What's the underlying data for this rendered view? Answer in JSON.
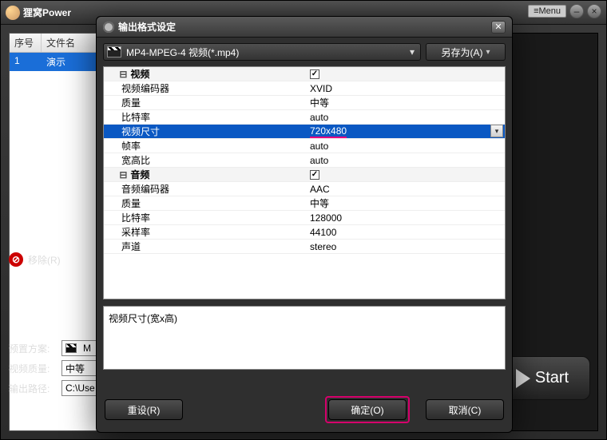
{
  "app": {
    "title_prefix": "狸窝Power",
    "menu_label": "≡Menu"
  },
  "file_list": {
    "col_index": "序号",
    "col_name": "文件名",
    "rows": [
      {
        "index": "1",
        "name": "演示"
      }
    ]
  },
  "remove_label": "移除(R)",
  "settings": {
    "preset_label": "预置方案:",
    "preset_value": "M",
    "quality_label": "视频质量:",
    "quality_value": "中等",
    "outdir_label": "输出路径:",
    "outdir_value": "C:\\Use"
  },
  "start_label": "Start",
  "dialog": {
    "title": "输出格式设定",
    "format_label": "MP4-MPEG-4 视频(*.mp4)",
    "save_as": "另存为(A)",
    "groups": {
      "video": "视频",
      "audio": "音频"
    },
    "props": {
      "video_codec": {
        "label": "视频编码器",
        "value": "XVID"
      },
      "video_quality": {
        "label": "质量",
        "value": "中等"
      },
      "video_bitrate": {
        "label": "比特率",
        "value": "auto"
      },
      "video_size": {
        "label": "视频尺寸",
        "value": "720x480"
      },
      "video_fps": {
        "label": "帧率",
        "value": "auto"
      },
      "video_aspect": {
        "label": "宽高比",
        "value": "auto"
      },
      "audio_codec": {
        "label": "音频编码器",
        "value": "AAC"
      },
      "audio_quality": {
        "label": "质量",
        "value": "中等"
      },
      "audio_bitrate": {
        "label": "比特率",
        "value": "128000"
      },
      "audio_sample": {
        "label": "采样率",
        "value": "44100"
      },
      "audio_channel": {
        "label": "声道",
        "value": "stereo"
      }
    },
    "description": "视频尺寸(宽x高)",
    "btn_reset": "重设(R)",
    "btn_ok": "确定(O)",
    "btn_cancel": "取消(C)"
  }
}
